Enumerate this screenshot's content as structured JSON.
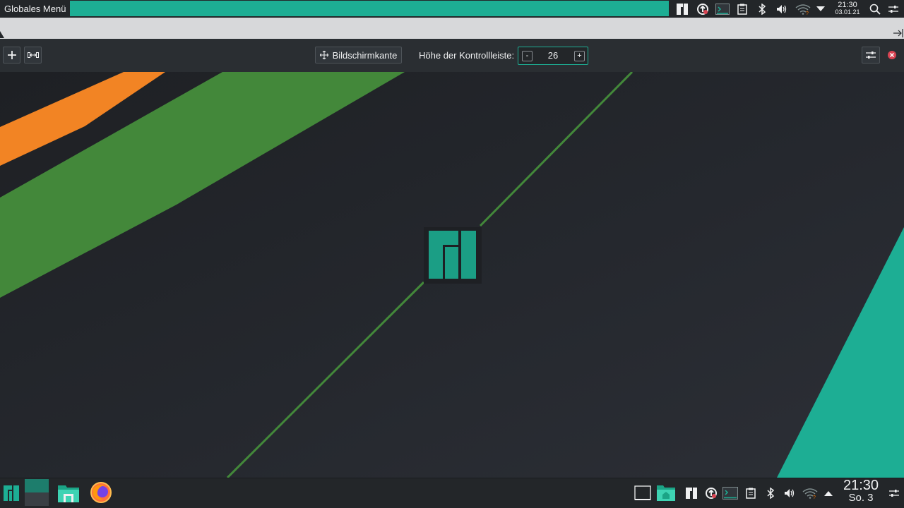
{
  "top_panel": {
    "global_menu_label": "Globales Menü",
    "clock_time": "21:30",
    "clock_date": "03.01.21",
    "icons": [
      "manjaro-logo-icon",
      "update-icon",
      "terminal-icon",
      "clipboard-icon",
      "bluetooth-icon",
      "volume-icon",
      "wifi-icon",
      "tray-expand-icon",
      "search-icon",
      "panel-settings-icon"
    ]
  },
  "edit_toolbar": {
    "add_icon": "plus-icon",
    "spacer_icon": "spacer-icon",
    "screen_edge_label": "Bildschirmkante",
    "height_label": "Höhe der Kontrollleiste:",
    "height_minus": "-",
    "height_value": "26",
    "height_plus": "+",
    "more_settings_icon": "settings-icon",
    "close_icon": "close-icon"
  },
  "bottom_panel": {
    "clock_time": "21:30",
    "clock_date": "So. 3",
    "launchers": [
      "application-menu-icon",
      "pager-icon",
      "file-manager-icon",
      "firefox-icon"
    ],
    "tray": [
      "show-desktop-icon",
      "home-folder-icon",
      "manjaro-logo-icon",
      "update-icon",
      "terminal-icon",
      "clipboard-icon",
      "bluetooth-icon",
      "volume-icon",
      "wifi-icon",
      "tray-expand-icon",
      "panel-settings-icon"
    ]
  },
  "colors": {
    "accent": "#1dae94",
    "green_stripe": "#43883a",
    "orange_stripe": "#f28424",
    "panel": "#232629"
  }
}
